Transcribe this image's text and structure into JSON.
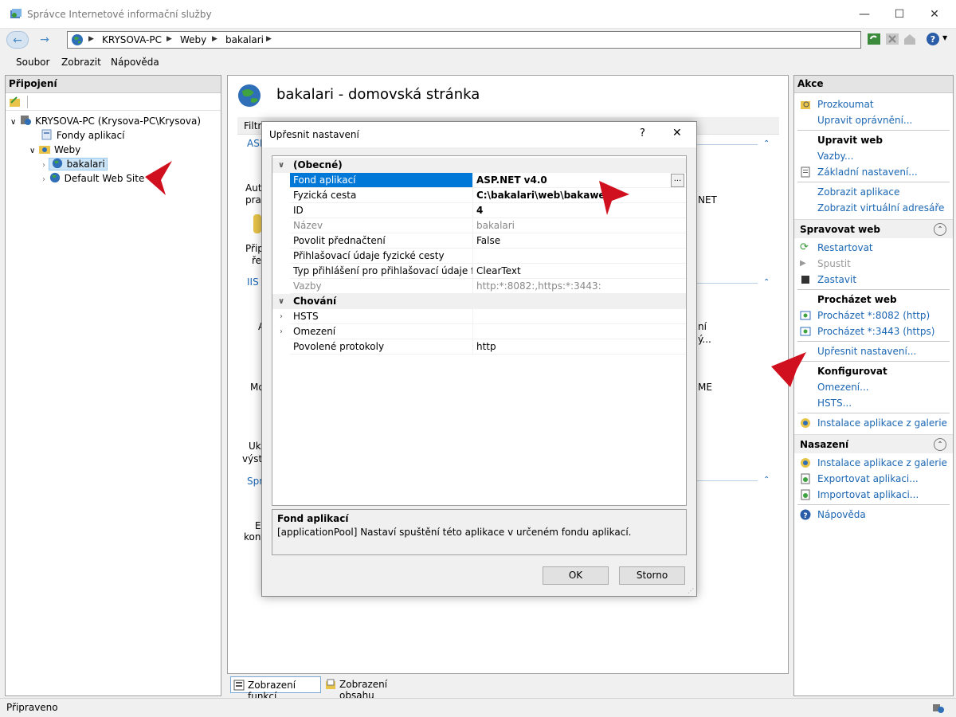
{
  "window": {
    "title": "Správce Internetové informační služby"
  },
  "address": {
    "crumbs": [
      "KRYSOVA-PC",
      "Weby",
      "bakalari"
    ]
  },
  "menu": [
    "Soubor",
    "Zobrazit",
    "Nápověda"
  ],
  "left": {
    "title": "Připojení",
    "tree": {
      "server": "KRYSOVA-PC (Krysova-PC\\Krysova)",
      "pools": "Fondy aplikací",
      "sites": "Weby",
      "site1": "bakalari",
      "site2": "Default Web Site"
    }
  },
  "center": {
    "title": "bakalari - domovská stránka",
    "filter_label": "Filtr:",
    "frag": {
      "asp": "ASP",
      "auto": "Auto",
      "prav": "prav",
      "prip": "Přip",
      "ret": "řet",
      "iis": "IIS",
      "a": "A",
      "mo": "Mo",
      "ukl": "Ukl",
      "vystu": "výstu",
      "spra": "Spra",
      "ed": "Ed",
      "konf": "konf",
      "net": "NET",
      "ni": "ní",
      "y": "ý...",
      "me": "ME"
    },
    "tabs": {
      "features": "Zobrazení funkcí",
      "content": "Zobrazení obsahu"
    }
  },
  "dialog": {
    "title": "Upřesnit nastavení",
    "help": "?",
    "close": "✕",
    "rows": [
      {
        "name": "(Obecné)",
        "value": "",
        "type": "category",
        "exp": "∨"
      },
      {
        "name": "Fond aplikací",
        "value": "ASP.NET v4.0",
        "type": "selected",
        "exp": ""
      },
      {
        "name": "Fyzická cesta",
        "value": "C:\\bakalari\\web\\bakaweb",
        "type": "bold",
        "exp": ""
      },
      {
        "name": "ID",
        "value": "4",
        "type": "bold",
        "exp": ""
      },
      {
        "name": "Název",
        "value": "bakalari",
        "type": "grey",
        "exp": ""
      },
      {
        "name": "Povolit přednačtení",
        "value": "False",
        "type": "normal",
        "exp": ""
      },
      {
        "name": "Přihlašovací údaje fyzické cesty",
        "value": "",
        "type": "normal",
        "exp": ""
      },
      {
        "name": "Typ přihlášení pro přihlašovací údaje fyzick",
        "value": "ClearText",
        "type": "normal",
        "exp": ""
      },
      {
        "name": "Vazby",
        "value": "http:*:8082:,https:*:3443:",
        "type": "grey",
        "exp": ""
      },
      {
        "name": "Chování",
        "value": "",
        "type": "category",
        "exp": "∨"
      },
      {
        "name": "HSTS",
        "value": "",
        "type": "normal",
        "exp": "›"
      },
      {
        "name": "Omezení",
        "value": "",
        "type": "normal",
        "exp": "›"
      },
      {
        "name": "Povolené protokoly",
        "value": "http",
        "type": "normal",
        "exp": ""
      }
    ],
    "ellipsis": "...",
    "desc_title": "Fond aplikací",
    "desc_text": "[applicationPool] Nastaví spuštění této aplikace v určeném fondu aplikací.",
    "ok": "OK",
    "cancel": "Storno"
  },
  "right": {
    "title": "Akce",
    "explore": "Prozkoumat",
    "edit_perms": "Upravit oprávnění...",
    "edit_site": "Upravit web",
    "bindings": "Vazby...",
    "basic": "Základní nastavení...",
    "view_apps": "Zobrazit aplikace",
    "view_vdirs": "Zobrazit virtuální adresáře",
    "manage": "Spravovat web",
    "restart": "Restartovat",
    "start": "Spustit",
    "stop": "Zastavit",
    "browse": "Procházet web",
    "browse_http": "Procházet *:8082 (http)",
    "browse_https": "Procházet *:3443 (https)",
    "advanced": "Upřesnit nastavení...",
    "configure": "Konfigurovat",
    "limits": "Omezení...",
    "hsts": "HSTS...",
    "gallery": "Instalace aplikace z galerie",
    "deploy": "Nasazení",
    "deploy_gallery": "Instalace aplikace z galerie",
    "export": "Exportovat aplikaci...",
    "import": "Importovat aplikaci...",
    "help": "Nápověda"
  },
  "status": {
    "text": "Připraveno"
  },
  "colors": {
    "link": "#1a66b3",
    "selection": "#0078d7",
    "arrow": "#d0101e"
  }
}
